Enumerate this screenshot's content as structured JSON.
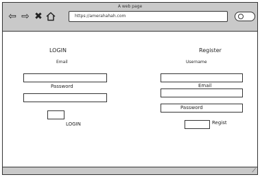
{
  "window": {
    "title": "A web page"
  },
  "toolbar": {
    "back_icon": "back-arrow-icon",
    "forward_icon": "forward-arrow-icon",
    "stop_icon": "close-icon",
    "home_icon": "home-icon",
    "address_value": "https://amerahahah.com",
    "search_icon": "search-icon"
  },
  "login": {
    "heading": "LOGIN",
    "email_label": "Email",
    "password_label": "Password",
    "button_label": "LOGIN"
  },
  "register": {
    "heading": "Register",
    "username_label": "Username",
    "email_label": "Email",
    "password_label": "Password",
    "button_label": "Regist"
  }
}
